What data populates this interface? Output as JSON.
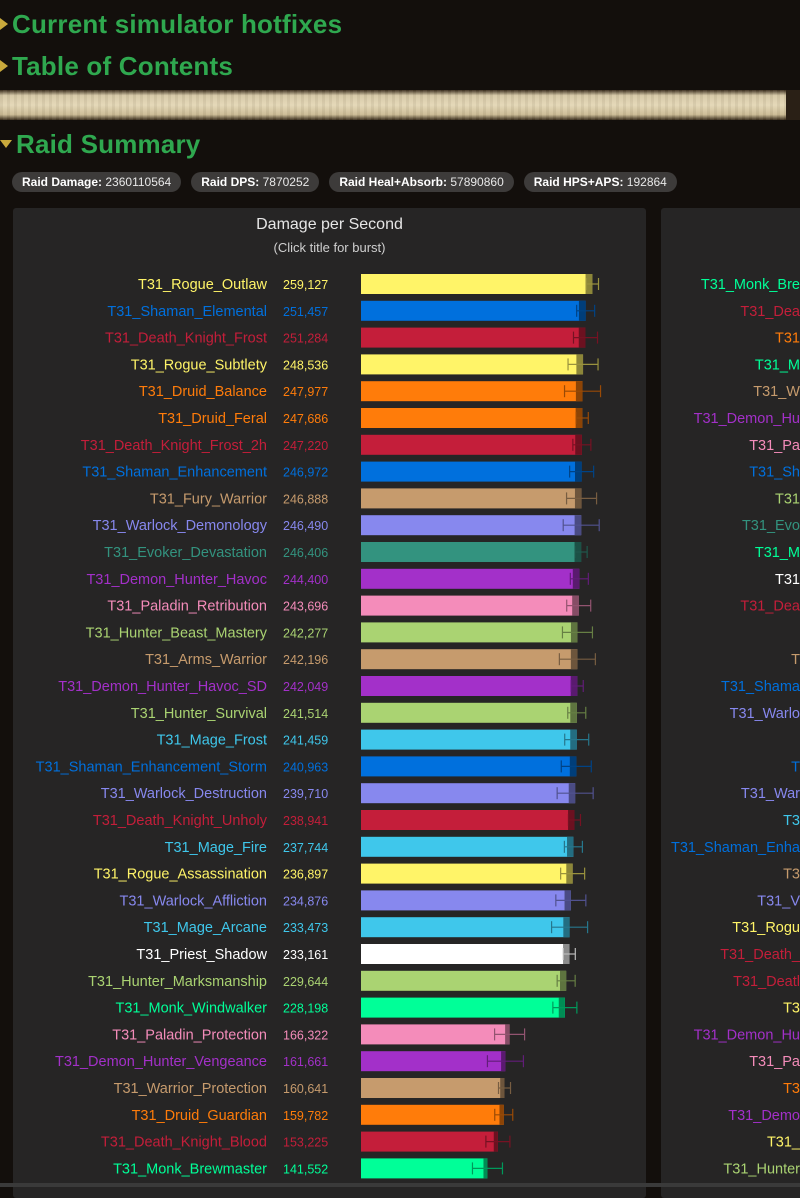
{
  "sections": {
    "hotfixes": "Current simulator hotfixes",
    "toc": "Table of Contents",
    "raid_summary": "Raid Summary"
  },
  "stats": [
    {
      "label": "Raid Damage:",
      "value": "2360110564"
    },
    {
      "label": "Raid DPS:",
      "value": "7870252"
    },
    {
      "label": "Raid Heal+Absorb:",
      "value": "57890860"
    },
    {
      "label": "Raid HPS+APS:",
      "value": "192864"
    }
  ],
  "chart_data": {
    "type": "bar",
    "orientation": "horizontal",
    "title": "Damage per Second",
    "subtitle": "(Click title for burst)",
    "categories": [
      "T31_Rogue_Outlaw",
      "T31_Shaman_Elemental",
      "T31_Death_Knight_Frost",
      "T31_Rogue_Subtlety",
      "T31_Druid_Balance",
      "T31_Druid_Feral",
      "T31_Death_Knight_Frost_2h",
      "T31_Shaman_Enhancement",
      "T31_Fury_Warrior",
      "T31_Warlock_Demonology",
      "T31_Evoker_Devastation",
      "T31_Demon_Hunter_Havoc",
      "T31_Paladin_Retribution",
      "T31_Hunter_Beast_Mastery",
      "T31_Arms_Warrior",
      "T31_Demon_Hunter_Havoc_SD",
      "T31_Hunter_Survival",
      "T31_Mage_Frost",
      "T31_Shaman_Enhancement_Storm",
      "T31_Warlock_Destruction",
      "T31_Death_Knight_Unholy",
      "T31_Mage_Fire",
      "T31_Rogue_Assassination",
      "T31_Warlock_Affliction",
      "T31_Mage_Arcane",
      "T31_Priest_Shadow",
      "T31_Hunter_Marksmanship",
      "T31_Monk_Windwalker",
      "T31_Paladin_Protection",
      "T31_Demon_Hunter_Vengeance",
      "T31_Warrior_Protection",
      "T31_Druid_Guardian",
      "T31_Death_Knight_Blood",
      "T31_Monk_Brewmaster"
    ],
    "value_labels": [
      "259,127",
      "251,457",
      "251,284",
      "248,536",
      "247,977",
      "247,686",
      "247,220",
      "246,972",
      "246,888",
      "246,490",
      "246,406",
      "244,400",
      "243,696",
      "242,277",
      "242,196",
      "242,049",
      "241,514",
      "241,459",
      "240,963",
      "239,710",
      "238,941",
      "237,744",
      "236,897",
      "234,876",
      "233,473",
      "233,161",
      "229,644",
      "228,198",
      "166,322",
      "161,661",
      "160,641",
      "159,782",
      "153,225",
      "141,552"
    ],
    "values": [
      259127,
      251457,
      251284,
      248536,
      247977,
      247686,
      247220,
      246972,
      246888,
      246490,
      246406,
      244400,
      243696,
      242277,
      242196,
      242049,
      241514,
      241459,
      240963,
      239710,
      238941,
      237744,
      236897,
      234876,
      233473,
      233161,
      229644,
      228198,
      166322,
      161661,
      160641,
      159782,
      153225,
      141552
    ],
    "colors": [
      "#fff468",
      "#0070dd",
      "#c41e3a",
      "#fff468",
      "#ff7c0a",
      "#ff7c0a",
      "#c41e3a",
      "#0070dd",
      "#c69b6d",
      "#8788ee",
      "#33937f",
      "#a330c9",
      "#f48cba",
      "#aad372",
      "#c69b6d",
      "#a330c9",
      "#aad372",
      "#3fc7eb",
      "#0070dd",
      "#8788ee",
      "#c41e3a",
      "#3fc7eb",
      "#fff468",
      "#8788ee",
      "#3fc7eb",
      "#ffffff",
      "#aad372",
      "#00ff98",
      "#f48cba",
      "#a330c9",
      "#c69b6d",
      "#ff7c0a",
      "#c41e3a",
      "#00ff98"
    ]
  },
  "right_panel": {
    "labels": [
      {
        "text": "T31_Monk_Bre",
        "color": "#00ff98"
      },
      {
        "text": "T31_Dea",
        "color": "#c41e3a"
      },
      {
        "text": "T31",
        "color": "#ff7c0a"
      },
      {
        "text": "T31_M",
        "color": "#00ff98"
      },
      {
        "text": "T31_W",
        "color": "#c69b6d"
      },
      {
        "text": "T31_Demon_Hu",
        "color": "#a330c9"
      },
      {
        "text": "T31_Pa",
        "color": "#f48cba"
      },
      {
        "text": "T31_Sh",
        "color": "#0070dd"
      },
      {
        "text": "T31",
        "color": "#aad372"
      },
      {
        "text": "T31_Evo",
        "color": "#33937f"
      },
      {
        "text": "T31_M",
        "color": "#00ff98"
      },
      {
        "text": "T31",
        "color": "#ffffff"
      },
      {
        "text": "T31_Dea",
        "color": "#c41e3a"
      },
      {
        "text": "",
        "color": "#c69b6d"
      },
      {
        "text": "T",
        "color": "#c69b6d"
      },
      {
        "text": "T31_Shama",
        "color": "#0070dd"
      },
      {
        "text": "T31_Warlo",
        "color": "#8788ee"
      },
      {
        "text": "",
        "color": "#3fc7eb"
      },
      {
        "text": "T",
        "color": "#0070dd"
      },
      {
        "text": "T31_War",
        "color": "#8788ee"
      },
      {
        "text": "T3",
        "color": "#3fc7eb"
      },
      {
        "text": "T31_Shaman_Enha",
        "color": "#0070dd"
      },
      {
        "text": "T3",
        "color": "#c69b6d"
      },
      {
        "text": "T31_V",
        "color": "#8788ee"
      },
      {
        "text": "T31_Rogu",
        "color": "#fff468"
      },
      {
        "text": "T31_Death_",
        "color": "#c41e3a"
      },
      {
        "text": "T31_Deatl",
        "color": "#c41e3a"
      },
      {
        "text": "T3",
        "color": "#fff468"
      },
      {
        "text": "T31_Demon_Hu",
        "color": "#a330c9"
      },
      {
        "text": "T31_Pa",
        "color": "#f48cba"
      },
      {
        "text": "T3",
        "color": "#ff7c0a"
      },
      {
        "text": "T31_Demo",
        "color": "#a330c9"
      },
      {
        "text": "T31_",
        "color": "#fff468"
      },
      {
        "text": "T31_Hunter",
        "color": "#aad372"
      }
    ]
  }
}
